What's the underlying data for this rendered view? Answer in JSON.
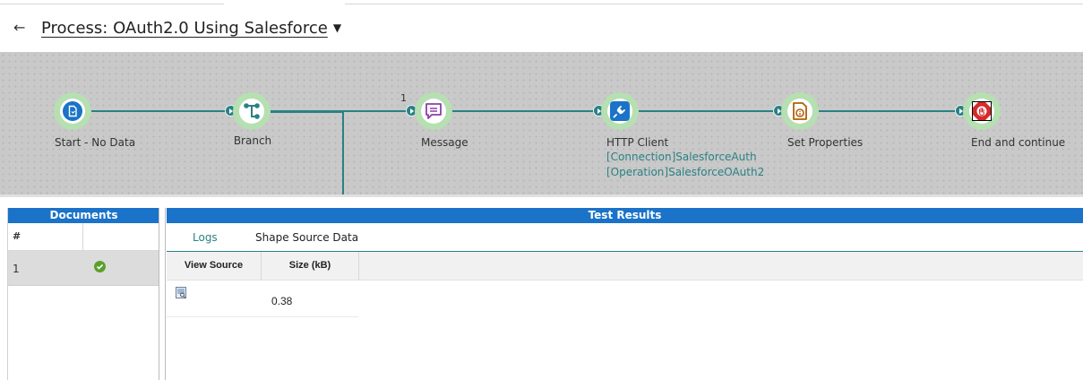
{
  "header": {
    "back_icon": "←",
    "title": "Process: OAuth2.0 Using Salesforce",
    "caret": "▼"
  },
  "canvas": {
    "shapes": [
      {
        "label": "Start - No Data",
        "icon": "start-document-icon"
      },
      {
        "label": "Branch",
        "icon": "branch-icon"
      },
      {
        "label": "Message",
        "icon": "message-icon",
        "count": "1"
      },
      {
        "label": "HTTP Client",
        "icon": "http-plug-icon",
        "details": [
          "[Connection]SalesforceAuth",
          "[Operation]SalesforceOAuth2"
        ]
      },
      {
        "label": "Set Properties",
        "icon": "set-properties-icon"
      },
      {
        "label": "End and continue",
        "icon": "stop-hand-icon"
      }
    ],
    "colors": {
      "connector": "#2b8184",
      "shape_halo": "#b6dfb2",
      "canvas_bg": "#c9c9c9"
    }
  },
  "documents": {
    "title": "Documents",
    "col_num": "#",
    "rows": [
      {
        "num": "1",
        "status": "success"
      }
    ]
  },
  "test_results": {
    "title": "Test Results",
    "tabs": [
      "Logs",
      "Shape Source Data"
    ],
    "active_tab": "Shape Source Data",
    "columns": [
      "View Source",
      "Size (kB)"
    ],
    "rows": [
      {
        "size": "0.38",
        "source_icon": "view-source-icon"
      }
    ]
  },
  "colors": {
    "panel_header": "#1a73c8",
    "success": "#5aa02c"
  }
}
